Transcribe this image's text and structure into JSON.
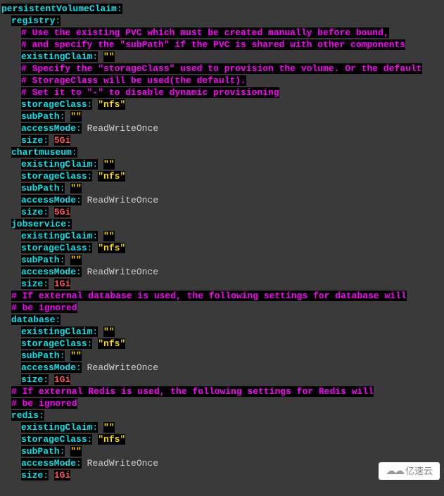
{
  "lines": [
    {
      "ind": 0,
      "parts": [
        {
          "t": "key",
          "v": "persistentVolumeClaim"
        },
        {
          "t": "colon",
          "v": ":"
        }
      ]
    },
    {
      "ind": 1,
      "parts": [
        {
          "t": "key",
          "v": "registry"
        },
        {
          "t": "colon",
          "v": ":"
        }
      ]
    },
    {
      "ind": 2,
      "parts": [
        {
          "t": "comment",
          "v": "# Use the existing PVC which must be created manually before bound,"
        }
      ]
    },
    {
      "ind": 2,
      "parts": [
        {
          "t": "comment",
          "v": "# and specify the \"subPath\" if the PVC is shared with other components"
        }
      ]
    },
    {
      "ind": 2,
      "parts": [
        {
          "t": "key",
          "v": "existingClaim"
        },
        {
          "t": "colon",
          "v": ":"
        },
        {
          "t": "plain",
          "v": " "
        },
        {
          "t": "string",
          "v": "\"\""
        }
      ]
    },
    {
      "ind": 2,
      "parts": [
        {
          "t": "comment",
          "v": "# Specify the \"storageClass\" used to provision the volume. Or the default"
        }
      ]
    },
    {
      "ind": 2,
      "parts": [
        {
          "t": "comment",
          "v": "# StorageClass will be used(the default)."
        }
      ]
    },
    {
      "ind": 2,
      "parts": [
        {
          "t": "comment",
          "v": "# Set it to \"-\" to disable dynamic provisioning"
        }
      ]
    },
    {
      "ind": 2,
      "parts": [
        {
          "t": "key",
          "v": "storageClass"
        },
        {
          "t": "colon",
          "v": ":"
        },
        {
          "t": "plain",
          "v": " "
        },
        {
          "t": "string",
          "v": "\"nfs\""
        }
      ]
    },
    {
      "ind": 2,
      "parts": [
        {
          "t": "key",
          "v": "subPath"
        },
        {
          "t": "colon",
          "v": ":"
        },
        {
          "t": "plain",
          "v": " "
        },
        {
          "t": "string",
          "v": "\"\""
        }
      ]
    },
    {
      "ind": 2,
      "parts": [
        {
          "t": "key",
          "v": "accessMode"
        },
        {
          "t": "colon",
          "v": ":"
        },
        {
          "t": "plain",
          "v": " ReadWriteOnce"
        }
      ]
    },
    {
      "ind": 2,
      "parts": [
        {
          "t": "key",
          "v": "size"
        },
        {
          "t": "colon",
          "v": ":"
        },
        {
          "t": "plain",
          "v": " "
        },
        {
          "t": "num",
          "v": "5Gi"
        }
      ]
    },
    {
      "ind": 1,
      "parts": [
        {
          "t": "key",
          "v": "chartmuseum"
        },
        {
          "t": "colon",
          "v": ":"
        }
      ]
    },
    {
      "ind": 2,
      "parts": [
        {
          "t": "key",
          "v": "existingClaim"
        },
        {
          "t": "colon",
          "v": ":"
        },
        {
          "t": "plain",
          "v": " "
        },
        {
          "t": "string",
          "v": "\"\""
        }
      ]
    },
    {
      "ind": 2,
      "parts": [
        {
          "t": "key",
          "v": "storageClass"
        },
        {
          "t": "colon",
          "v": ":"
        },
        {
          "t": "plain",
          "v": " "
        },
        {
          "t": "string",
          "v": "\"nfs\""
        }
      ]
    },
    {
      "ind": 2,
      "parts": [
        {
          "t": "key",
          "v": "subPath"
        },
        {
          "t": "colon",
          "v": ":"
        },
        {
          "t": "plain",
          "v": " "
        },
        {
          "t": "string",
          "v": "\"\""
        }
      ]
    },
    {
      "ind": 2,
      "parts": [
        {
          "t": "key",
          "v": "accessMode"
        },
        {
          "t": "colon",
          "v": ":"
        },
        {
          "t": "plain",
          "v": " ReadWriteOnce"
        }
      ]
    },
    {
      "ind": 2,
      "parts": [
        {
          "t": "key",
          "v": "size"
        },
        {
          "t": "colon",
          "v": ":"
        },
        {
          "t": "plain",
          "v": " "
        },
        {
          "t": "num",
          "v": "5Gi"
        }
      ]
    },
    {
      "ind": 1,
      "parts": [
        {
          "t": "key",
          "v": "jobservice"
        },
        {
          "t": "colon",
          "v": ":"
        }
      ]
    },
    {
      "ind": 2,
      "parts": [
        {
          "t": "key",
          "v": "existingClaim"
        },
        {
          "t": "colon",
          "v": ":"
        },
        {
          "t": "plain",
          "v": " "
        },
        {
          "t": "string",
          "v": "\"\""
        }
      ]
    },
    {
      "ind": 2,
      "parts": [
        {
          "t": "key",
          "v": "storageClass"
        },
        {
          "t": "colon",
          "v": ":"
        },
        {
          "t": "plain",
          "v": " "
        },
        {
          "t": "string",
          "v": "\"nfs\""
        }
      ]
    },
    {
      "ind": 2,
      "parts": [
        {
          "t": "key",
          "v": "subPath"
        },
        {
          "t": "colon",
          "v": ":"
        },
        {
          "t": "plain",
          "v": " "
        },
        {
          "t": "string",
          "v": "\"\""
        }
      ]
    },
    {
      "ind": 2,
      "parts": [
        {
          "t": "key",
          "v": "accessMode"
        },
        {
          "t": "colon",
          "v": ":"
        },
        {
          "t": "plain",
          "v": " ReadWriteOnce"
        }
      ]
    },
    {
      "ind": 2,
      "parts": [
        {
          "t": "key",
          "v": "size"
        },
        {
          "t": "colon",
          "v": ":"
        },
        {
          "t": "plain",
          "v": " "
        },
        {
          "t": "num",
          "v": "1Gi"
        }
      ]
    },
    {
      "ind": 1,
      "parts": [
        {
          "t": "comment",
          "v": "# If external database is used, the following settings for database will"
        }
      ]
    },
    {
      "ind": 1,
      "parts": [
        {
          "t": "comment",
          "v": "# be ignored"
        }
      ]
    },
    {
      "ind": 1,
      "parts": [
        {
          "t": "key",
          "v": "database"
        },
        {
          "t": "colon",
          "v": ":"
        }
      ]
    },
    {
      "ind": 2,
      "parts": [
        {
          "t": "key",
          "v": "existingClaim"
        },
        {
          "t": "colon",
          "v": ":"
        },
        {
          "t": "plain",
          "v": " "
        },
        {
          "t": "string",
          "v": "\"\""
        }
      ]
    },
    {
      "ind": 2,
      "parts": [
        {
          "t": "key",
          "v": "storageClass"
        },
        {
          "t": "colon",
          "v": ":"
        },
        {
          "t": "plain",
          "v": " "
        },
        {
          "t": "string",
          "v": "\"nfs\""
        }
      ]
    },
    {
      "ind": 2,
      "parts": [
        {
          "t": "key",
          "v": "subPath"
        },
        {
          "t": "colon",
          "v": ":"
        },
        {
          "t": "plain",
          "v": " "
        },
        {
          "t": "string",
          "v": "\"\""
        }
      ]
    },
    {
      "ind": 2,
      "parts": [
        {
          "t": "key",
          "v": "accessMode"
        },
        {
          "t": "colon",
          "v": ":"
        },
        {
          "t": "plain",
          "v": " ReadWriteOnce"
        }
      ]
    },
    {
      "ind": 2,
      "parts": [
        {
          "t": "key",
          "v": "size"
        },
        {
          "t": "colon",
          "v": ":"
        },
        {
          "t": "plain",
          "v": " "
        },
        {
          "t": "num",
          "v": "1Gi"
        }
      ]
    },
    {
      "ind": 1,
      "parts": [
        {
          "t": "comment",
          "v": "# If external Redis is used, the following settings for Redis will"
        }
      ]
    },
    {
      "ind": 1,
      "parts": [
        {
          "t": "comment",
          "v": "# be ignored"
        }
      ]
    },
    {
      "ind": 1,
      "parts": [
        {
          "t": "key",
          "v": "redis"
        },
        {
          "t": "colon",
          "v": ":"
        }
      ]
    },
    {
      "ind": 2,
      "parts": [
        {
          "t": "key",
          "v": "existingClaim"
        },
        {
          "t": "colon",
          "v": ":"
        },
        {
          "t": "plain",
          "v": " "
        },
        {
          "t": "string",
          "v": "\"\""
        }
      ]
    },
    {
      "ind": 2,
      "parts": [
        {
          "t": "key",
          "v": "storageClass"
        },
        {
          "t": "colon",
          "v": ":"
        },
        {
          "t": "plain",
          "v": " "
        },
        {
          "t": "string",
          "v": "\"nfs\""
        }
      ]
    },
    {
      "ind": 2,
      "parts": [
        {
          "t": "key",
          "v": "subPath"
        },
        {
          "t": "colon",
          "v": ":"
        },
        {
          "t": "plain",
          "v": " "
        },
        {
          "t": "string",
          "v": "\"\""
        }
      ]
    },
    {
      "ind": 2,
      "parts": [
        {
          "t": "key",
          "v": "accessMode"
        },
        {
          "t": "colon",
          "v": ":"
        },
        {
          "t": "plain",
          "v": " ReadWriteOnce"
        }
      ]
    },
    {
      "ind": 2,
      "parts": [
        {
          "t": "key",
          "v": "size"
        },
        {
          "t": "colon",
          "v": ":"
        },
        {
          "t": "plain",
          "v": " "
        },
        {
          "t": "num",
          "v": "1Gi"
        }
      ]
    }
  ],
  "watermark": {
    "text": "亿速云"
  }
}
